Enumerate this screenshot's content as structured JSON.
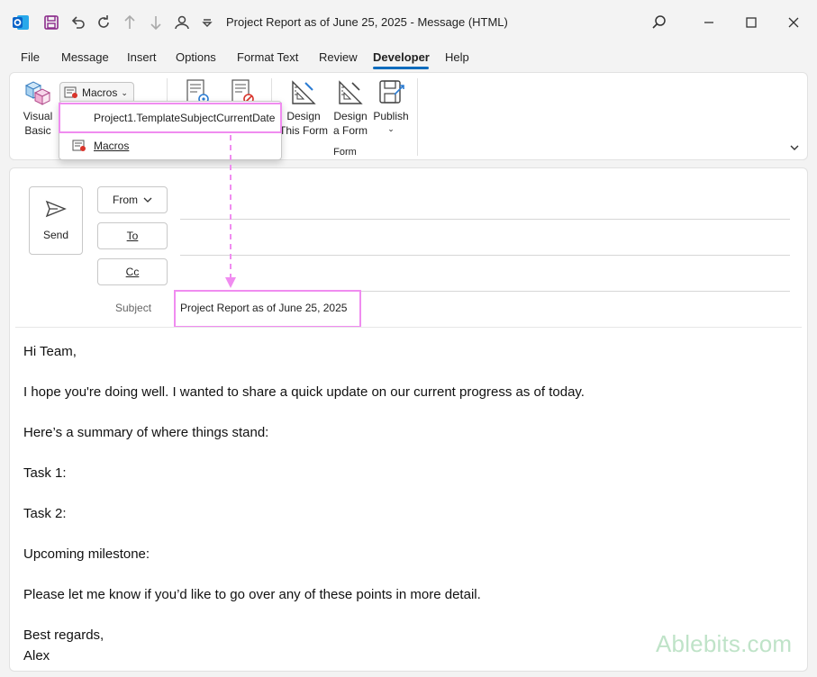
{
  "window": {
    "title": "Project Report as of June 25, 2025  -  Message (HTML)"
  },
  "menu": {
    "items": [
      "File",
      "Message",
      "Insert",
      "Options",
      "Format Text",
      "Review",
      "Developer",
      "Help"
    ],
    "active": "Developer"
  },
  "ribbon": {
    "visual_basic": [
      "Visual",
      "Basic"
    ],
    "macros_label": "Macros",
    "design_this_form": [
      "Design",
      "This Form"
    ],
    "design_a_form": [
      "Design",
      "a Form"
    ],
    "publish": "Publish",
    "group_form": "Form"
  },
  "dropdown": {
    "items": [
      "Project1.TemplateSubjectCurrentDate",
      "Macros"
    ]
  },
  "compose": {
    "send_label": "Send",
    "from_label": "From",
    "to_label": "To",
    "cc_label": "Cc",
    "subject_label": "Subject",
    "subject_value": "Project Report as of June 25, 2025"
  },
  "body": {
    "lines": [
      "Hi Team,",
      "I hope you're doing well. I wanted to share a quick update on our current progress as of today.",
      "Here’s a summary of where things stand:",
      "Task 1:",
      "Task 2:",
      "Upcoming milestone:",
      "Please let me know if you’d like to go over any of these points in more detail.",
      "Best regards,",
      "Alex"
    ]
  },
  "watermark": "Ablebits.com",
  "colors": {
    "accent": "#0f6cbd",
    "highlight": "#f08cf0",
    "outlook_blue": "#0a64c8"
  }
}
